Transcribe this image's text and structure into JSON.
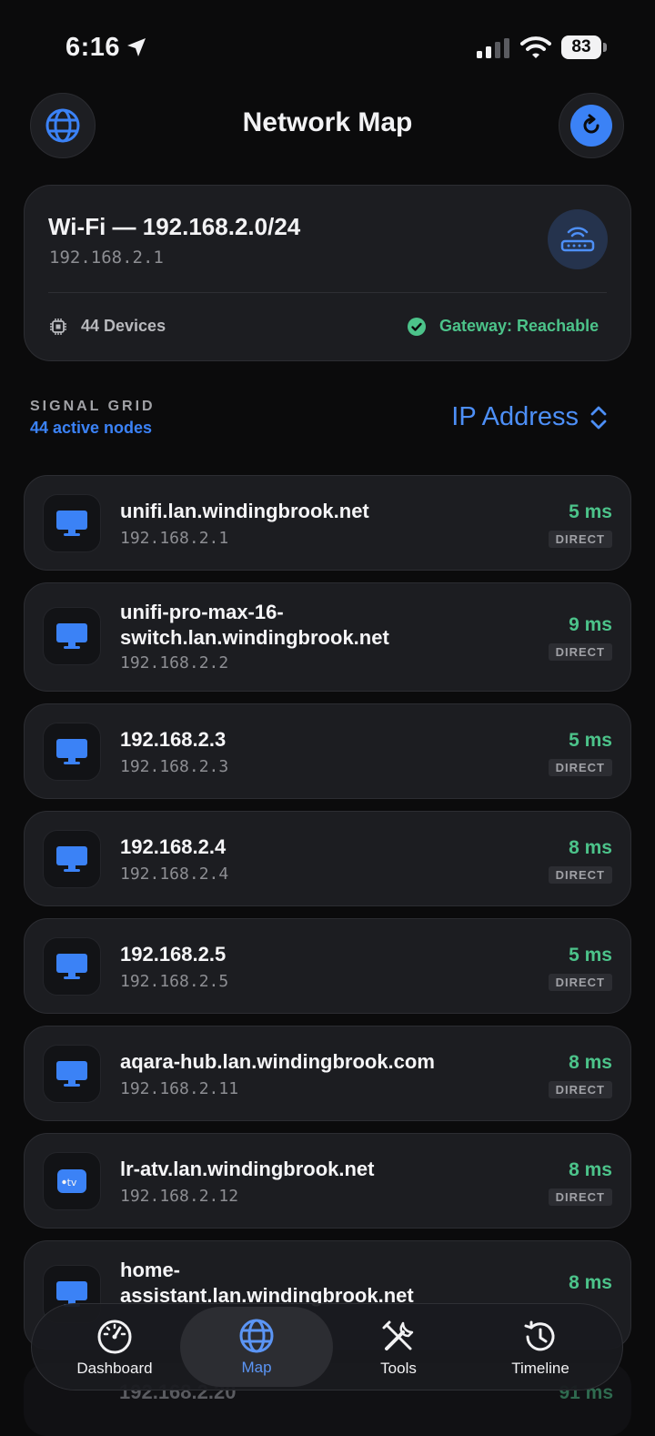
{
  "status_bar": {
    "time": "6:16",
    "battery": "83"
  },
  "header": {
    "title": "Network Map"
  },
  "network": {
    "title": "Wi-Fi — 192.168.2.0/24",
    "gateway_ip": "192.168.2.1",
    "device_count": "44 Devices",
    "gateway_status": "Gateway: Reachable"
  },
  "section": {
    "label": "SIGNAL GRID",
    "sub": "44 active nodes",
    "sort_value": "IP Address"
  },
  "devices": [
    {
      "name": "unifi.lan.windingbrook.net",
      "ip": "192.168.2.1",
      "latency": "5 ms",
      "conn": "DIRECT",
      "icon": "monitor-icon"
    },
    {
      "name": "unifi-pro-max-16-switch.lan.windingbrook.net",
      "name_l1": "unifi-pro-max-16-",
      "name_l2": "switch.lan.windingbrook.net",
      "ip": "192.168.2.2",
      "latency": "9 ms",
      "conn": "DIRECT",
      "icon": "monitor-icon"
    },
    {
      "name": "192.168.2.3",
      "ip": "192.168.2.3",
      "latency": "5 ms",
      "conn": "DIRECT",
      "icon": "monitor-icon"
    },
    {
      "name": "192.168.2.4",
      "ip": "192.168.2.4",
      "latency": "8 ms",
      "conn": "DIRECT",
      "icon": "monitor-icon"
    },
    {
      "name": "192.168.2.5",
      "ip": "192.168.2.5",
      "latency": "5 ms",
      "conn": "DIRECT",
      "icon": "monitor-icon"
    },
    {
      "name": "aqara-hub.lan.windingbrook.com",
      "ip": "192.168.2.11",
      "latency": "8 ms",
      "conn": "DIRECT",
      "icon": "monitor-icon"
    },
    {
      "name": "lr-atv.lan.windingbrook.net",
      "ip": "192.168.2.12",
      "latency": "8 ms",
      "conn": "DIRECT",
      "icon": "apple-tv-icon"
    },
    {
      "name": "home-assistant.lan.windingbrook.net",
      "name_l1": "home-",
      "name_l2": "assistant.lan.windingbrook.net",
      "latency": "8 ms",
      "icon": "monitor-icon"
    }
  ],
  "partial_row": {
    "name": "192.168.2.20",
    "latency": "91 ms"
  },
  "tabs": [
    {
      "label": "Dashboard",
      "icon": "gauge-icon"
    },
    {
      "label": "Map",
      "icon": "globe-icon",
      "active": true
    },
    {
      "label": "Tools",
      "icon": "tools-icon"
    },
    {
      "label": "Timeline",
      "icon": "history-icon"
    }
  ],
  "colors": {
    "accent": "#3b82f6",
    "ok": "#4cc38a",
    "background": "#0b0b0c",
    "card": "#1c1d21"
  }
}
